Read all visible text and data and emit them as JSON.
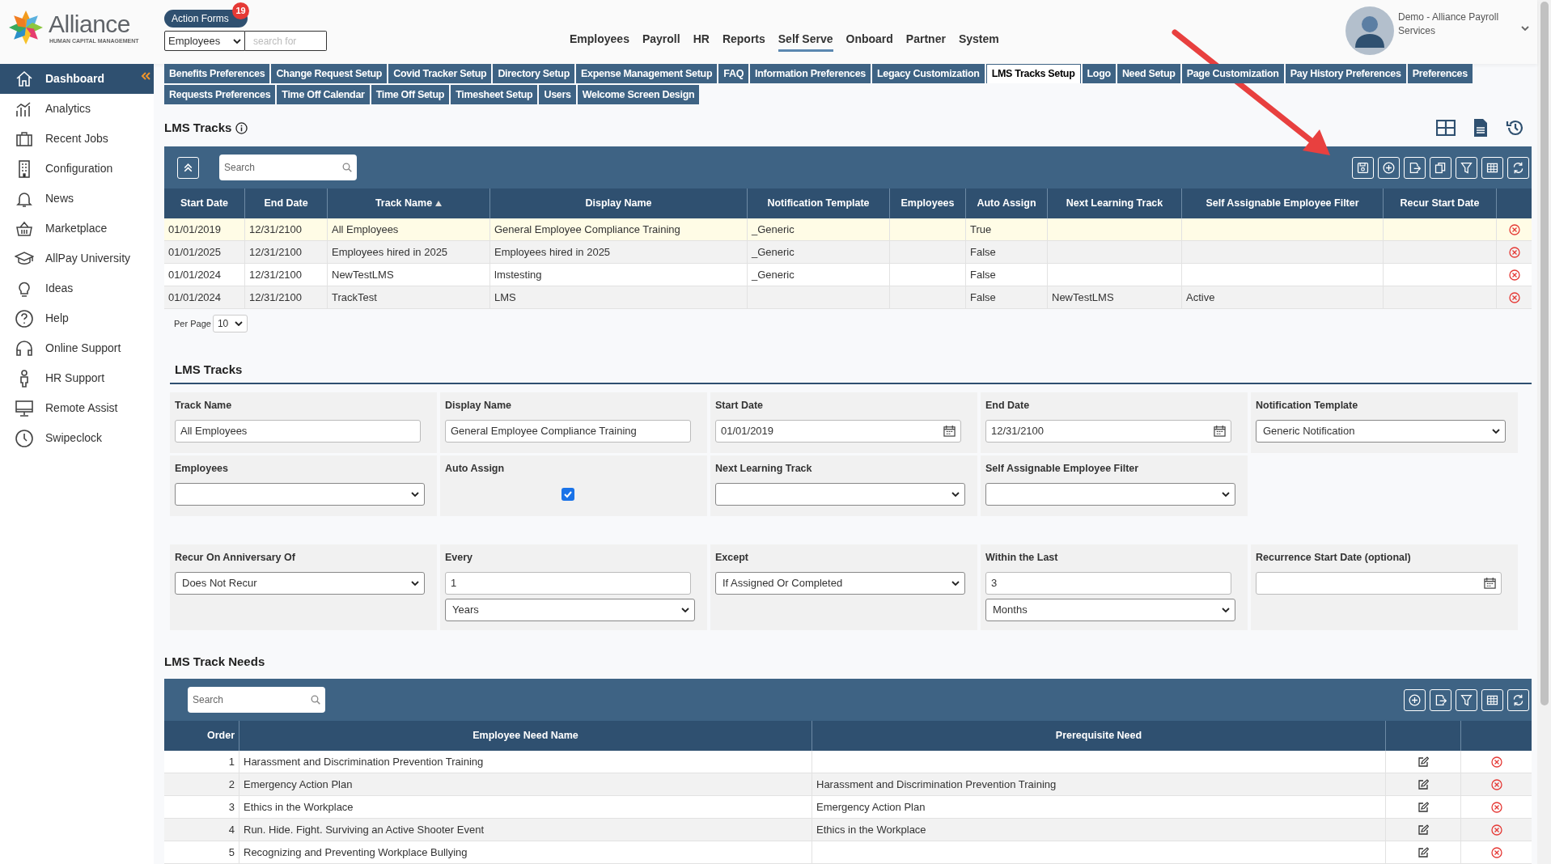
{
  "logo": {
    "name": "Alliance",
    "tagline": "HUMAN CAPITAL MANAGEMENT"
  },
  "action_forms": {
    "label": "Action Forms",
    "badge": "19"
  },
  "search_bar": {
    "category": "Employees",
    "placeholder": "search for"
  },
  "top_nav": [
    {
      "label": "Employees",
      "selected": false
    },
    {
      "label": "Payroll",
      "selected": false
    },
    {
      "label": "HR",
      "selected": false
    },
    {
      "label": "Reports",
      "selected": false
    },
    {
      "label": "Self Serve",
      "selected": true
    },
    {
      "label": "Onboard",
      "selected": false
    },
    {
      "label": "Partner",
      "selected": false
    },
    {
      "label": "System",
      "selected": false
    }
  ],
  "user": {
    "name": "Demo - Alliance Payroll Services"
  },
  "sidebar": {
    "items": [
      {
        "label": "Dashboard",
        "selected": true
      },
      {
        "label": "Analytics",
        "selected": false
      },
      {
        "label": "Recent Jobs",
        "selected": false
      },
      {
        "label": "Configuration",
        "selected": false
      },
      {
        "label": "News",
        "selected": false
      },
      {
        "label": "Marketplace",
        "selected": false
      },
      {
        "label": "AllPay University",
        "selected": false
      },
      {
        "label": "Ideas",
        "selected": false
      },
      {
        "label": "Help",
        "selected": false
      },
      {
        "label": "Online Support",
        "selected": false
      },
      {
        "label": "HR Support",
        "selected": false
      },
      {
        "label": "Remote Assist",
        "selected": false
      },
      {
        "label": "Swipeclock",
        "selected": false
      }
    ]
  },
  "tab_rows": [
    [
      {
        "label": "Benefits Preferences",
        "selected": false
      },
      {
        "label": "Change Request Setup",
        "selected": false
      },
      {
        "label": "Covid Tracker Setup",
        "selected": false
      },
      {
        "label": "Directory Setup",
        "selected": false
      },
      {
        "label": "Expense Management Setup",
        "selected": false
      },
      {
        "label": "FAQ",
        "selected": false
      },
      {
        "label": "Information Preferences",
        "selected": false
      },
      {
        "label": "Legacy Customization",
        "selected": false
      },
      {
        "label": "LMS Tracks Setup",
        "selected": true
      },
      {
        "label": "Logo",
        "selected": false
      },
      {
        "label": "Need Setup",
        "selected": false
      },
      {
        "label": "Page Customization",
        "selected": false
      },
      {
        "label": "Pay History Preferences",
        "selected": false
      },
      {
        "label": "Preferences",
        "selected": false
      }
    ],
    [
      {
        "label": "Requests Preferences",
        "selected": false
      },
      {
        "label": "Time Off Calendar",
        "selected": false
      },
      {
        "label": "Time Off Setup",
        "selected": false
      },
      {
        "label": "Timesheet Setup",
        "selected": false
      },
      {
        "label": "Users",
        "selected": false
      },
      {
        "label": "Welcome Screen Design",
        "selected": false
      }
    ]
  ],
  "tracks_grid": {
    "title": "LMS Tracks",
    "search_placeholder": "Search",
    "columns": [
      {
        "label": "Start Date",
        "sorted": false
      },
      {
        "label": "End Date",
        "sorted": false
      },
      {
        "label": "Track Name",
        "sorted": true
      },
      {
        "label": "Display Name",
        "sorted": false
      },
      {
        "label": "Notification Template",
        "sorted": false
      },
      {
        "label": "Employees",
        "sorted": false
      },
      {
        "label": "Auto Assign",
        "sorted": false
      },
      {
        "label": "Next Learning Track",
        "sorted": false
      },
      {
        "label": "Self Assignable Employee Filter",
        "sorted": false
      },
      {
        "label": "Recur Start Date",
        "sorted": false
      }
    ],
    "rows": [
      {
        "selected": true,
        "start_date": "01/01/2019",
        "end_date": "12/31/2100",
        "track_name": "All Employees",
        "display_name": "General Employee Compliance Training",
        "notification_template": "_Generic",
        "auto_assign": "True"
      },
      {
        "selected": false,
        "start_date": "01/01/2025",
        "end_date": "12/31/2100",
        "track_name": "Employees hired in 2025",
        "display_name": "Employees hired in 2025",
        "notification_template": "_Generic",
        "auto_assign": "False"
      },
      {
        "selected": false,
        "start_date": "01/01/2024",
        "end_date": "12/31/2100",
        "track_name": "NewTestLMS",
        "display_name": "lmstesting",
        "notification_template": "_Generic",
        "auto_assign": "False"
      },
      {
        "selected": false,
        "start_date": "01/01/2024",
        "end_date": "12/31/2100",
        "track_name": "TrackTest",
        "display_name": "LMS",
        "auto_assign": "False",
        "next_learning_track": "NewTestLMS",
        "self_assignable_filter": "Active"
      }
    ],
    "per_page": {
      "label": "Per Page",
      "value": "10"
    }
  },
  "form": {
    "title": "LMS Tracks",
    "rows": [
      [
        {
          "label": "Track Name",
          "controls": [
            {
              "kind": "text",
              "value": "All Employees"
            }
          ]
        },
        {
          "label": "Display Name",
          "controls": [
            {
              "kind": "text",
              "value": "General Employee Compliance Training"
            }
          ]
        },
        {
          "label": "Start Date",
          "controls": [
            {
              "kind": "date",
              "value": "01/01/2019"
            }
          ]
        },
        {
          "label": "End Date",
          "controls": [
            {
              "kind": "date",
              "value": "12/31/2100"
            }
          ]
        },
        {
          "label": "Notification Template",
          "controls": [
            {
              "kind": "select",
              "value": "Generic Notification"
            }
          ]
        }
      ],
      [
        {
          "label": "Employees",
          "controls": [
            {
              "kind": "select"
            }
          ]
        },
        {
          "label": "Auto Assign",
          "controls": [
            {
              "kind": "checkbox",
              "checked": true
            }
          ]
        },
        {
          "label": "Next Learning Track",
          "controls": [
            {
              "kind": "select"
            }
          ]
        },
        {
          "label": "Self Assignable Employee Filter",
          "controls": [
            {
              "kind": "select"
            }
          ]
        }
      ],
      [
        {
          "label": "Recur On Anniversary Of",
          "controls": [
            {
              "kind": "select",
              "value": "Does Not Recur"
            }
          ]
        },
        {
          "label": "Every",
          "controls": [
            {
              "kind": "text",
              "value": "1"
            },
            {
              "kind": "select",
              "value": "Years"
            }
          ]
        },
        {
          "label": "Except",
          "controls": [
            {
              "kind": "select",
              "value": "If Assigned Or Completed"
            }
          ]
        },
        {
          "label": "Within the Last",
          "controls": [
            {
              "kind": "text",
              "value": "3"
            },
            {
              "kind": "select",
              "value": "Months"
            }
          ]
        },
        {
          "label": "Recurrence Start Date (optional)",
          "controls": [
            {
              "kind": "date"
            }
          ]
        }
      ]
    ]
  },
  "needs_grid": {
    "title": "LMS Track Needs",
    "search_placeholder": "Search",
    "columns": [
      "Order",
      "Employee Need Name",
      "Prerequisite Need"
    ],
    "rows": [
      {
        "order": "1",
        "name": "Harassment and Discrimination Prevention Training"
      },
      {
        "order": "2",
        "name": "Emergency Action Plan",
        "prerequisite": "Harassment and Discrimination Prevention Training"
      },
      {
        "order": "3",
        "name": "Ethics in the Workplace",
        "prerequisite": "Emergency Action Plan"
      },
      {
        "order": "4",
        "name": "Run. Hide. Fight. Surviving an Active Shooter Event",
        "prerequisite": "Ethics in the Workplace"
      },
      {
        "order": "5",
        "name": "Recognizing and Preventing Workplace Bullying"
      }
    ]
  }
}
